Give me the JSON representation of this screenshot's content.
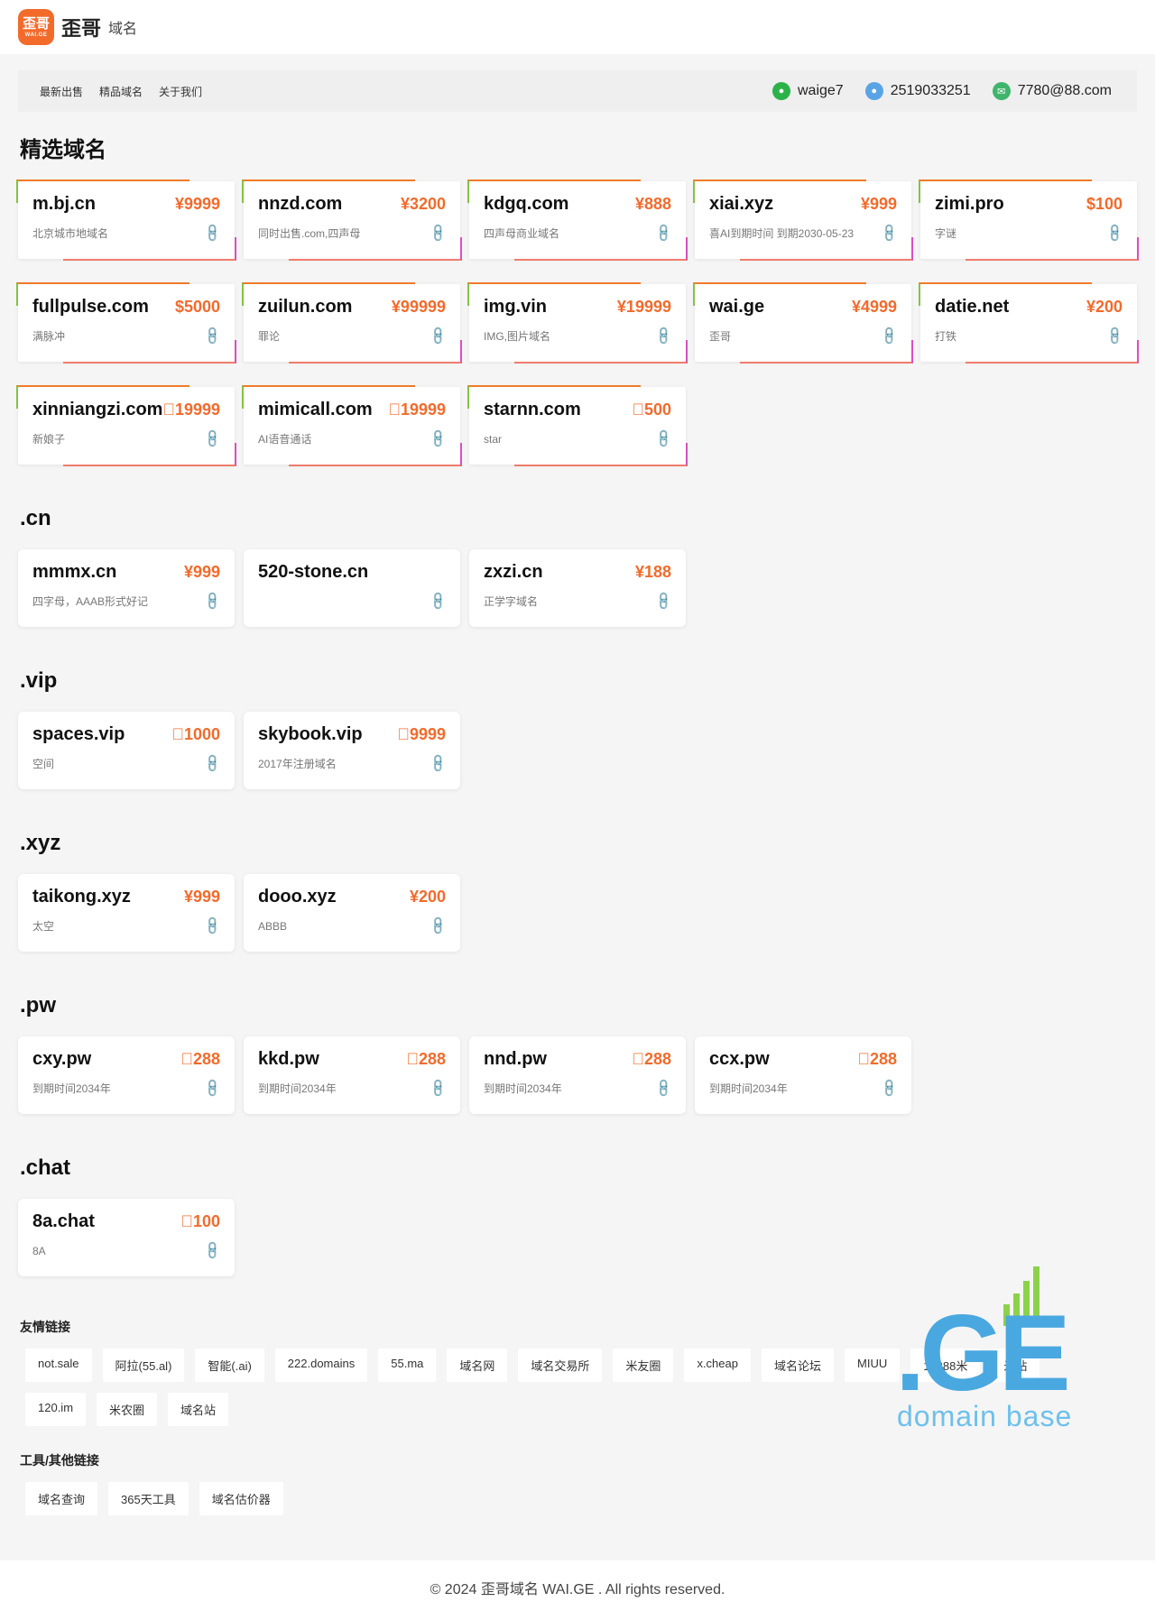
{
  "header": {
    "logo_top": "歪哥",
    "logo_bottom": "WAI.GE",
    "brand": "歪哥",
    "brand_sub": "域名"
  },
  "nav": {
    "links": [
      "最新出售",
      "精品域名",
      "关于我们"
    ],
    "wechat": "waige7",
    "qq": "2519033251",
    "email": "7780@88.com"
  },
  "sections": [
    {
      "title": "精选域名",
      "featured": true,
      "cards": [
        {
          "domain": "m.bj.cn",
          "price": "¥9999",
          "desc": "北京城市地域名"
        },
        {
          "domain": "nnzd.com",
          "price": "¥3200",
          "desc": "同时出售.com,四声母"
        },
        {
          "domain": "kdgq.com",
          "price": "¥888",
          "desc": "四声母商业域名"
        },
        {
          "domain": "xiai.xyz",
          "price": "¥999",
          "desc": "喜AI到期时间 到期2030-05-23"
        },
        {
          "domain": "zimi.pro",
          "price": "$100",
          "desc": "字谜"
        },
        {
          "domain": "fullpulse.com",
          "price": "$5000",
          "desc": "满脉冲"
        },
        {
          "domain": "zuilun.com",
          "price": "¥99999",
          "desc": "罪论"
        },
        {
          "domain": "img.vin",
          "price": "¥19999",
          "desc": "IMG,图片域名"
        },
        {
          "domain": "wai.ge",
          "price": "¥4999",
          "desc": "歪哥"
        },
        {
          "domain": "datie.net",
          "price": "¥200",
          "desc": "打铁"
        },
        {
          "domain": "xinniangzi.com",
          "price": "\u000019999",
          "desc": "新娘子"
        },
        {
          "domain": "mimicall.com",
          "price": "\u000019999",
          "desc": "AI语音通话"
        },
        {
          "domain": "starnn.com",
          "price": "\u0000500",
          "desc": "star"
        }
      ]
    },
    {
      "title": ".cn",
      "cards": [
        {
          "domain": "mmmx.cn",
          "price": "¥999",
          "desc": "四字母，AAAB形式好记"
        },
        {
          "domain": "520-stone.cn",
          "price": "",
          "desc": ""
        },
        {
          "domain": "zxzi.cn",
          "price": "¥188",
          "desc": "正学字域名"
        }
      ]
    },
    {
      "title": ".vip",
      "cards": [
        {
          "domain": "spaces.vip",
          "price": "\u00001000",
          "desc": "空间"
        },
        {
          "domain": "skybook.vip",
          "price": "\u00009999",
          "desc": "2017年注册域名"
        }
      ]
    },
    {
      "title": ".xyz",
      "cards": [
        {
          "domain": "taikong.xyz",
          "price": "¥999",
          "desc": "太空"
        },
        {
          "domain": "dooo.xyz",
          "price": "¥200",
          "desc": "ABBB"
        }
      ]
    },
    {
      "title": ".pw",
      "cards": [
        {
          "domain": "cxy.pw",
          "price": "\u0000288",
          "desc": "到期时间2034年"
        },
        {
          "domain": "kkd.pw",
          "price": "\u0000288",
          "desc": "到期时间2034年"
        },
        {
          "domain": "nnd.pw",
          "price": "\u0000288",
          "desc": "到期时间2034年"
        },
        {
          "domain": "ccx.pw",
          "price": "\u0000288",
          "desc": "到期时间2034年"
        }
      ]
    },
    {
      "title": ".chat",
      "cards": [
        {
          "domain": "8a.chat",
          "price": "\u0000100",
          "desc": "8A"
        }
      ]
    }
  ],
  "friend_links": {
    "title": "友情链接",
    "items": [
      "not.sale",
      "阿拉(55.al)",
      "智能(.ai)",
      "222.domains",
      "55.ma",
      "域名网",
      "域名交易所",
      "米友圈",
      "x.cheap",
      "域名论坛",
      "MIUU",
      "16888米",
      "米站",
      "120.im",
      "米农圈",
      "域名站"
    ]
  },
  "tools": {
    "title": "工具/其他链接",
    "items": [
      "域名查询",
      "365天工具",
      "域名估价器"
    ]
  },
  "brand_badge": {
    "big": ".GE",
    "sub": "domain base"
  },
  "footer": {
    "text": "© 2024 歪哥域名 WAI.GE . All rights reserved."
  }
}
